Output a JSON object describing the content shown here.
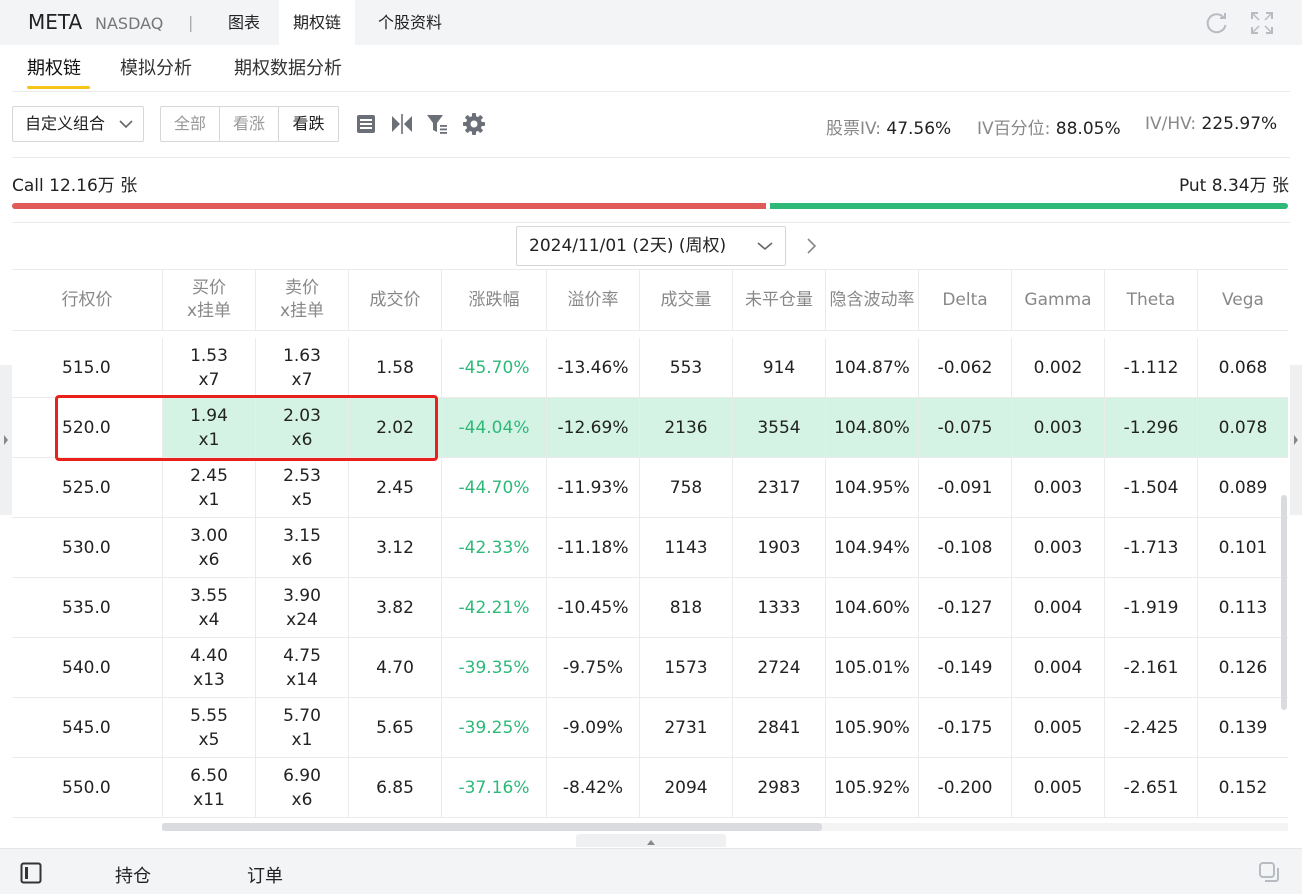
{
  "header": {
    "ticker": "META",
    "exchange": "NASDAQ",
    "separator": "|",
    "tabs": [
      {
        "label": "图表"
      },
      {
        "label": "期权链"
      },
      {
        "label": "个股资料"
      }
    ],
    "icons": [
      "refresh-icon",
      "expand-icon"
    ]
  },
  "subtabs": [
    {
      "label": "期权链"
    },
    {
      "label": "模拟分析"
    },
    {
      "label": "期权数据分析"
    }
  ],
  "toolbar": {
    "combo_label": "自定义组合",
    "segments": [
      {
        "label": "全部"
      },
      {
        "label": "看涨"
      },
      {
        "label": "看跌"
      }
    ],
    "stats": {
      "stock_iv_label": "股票IV:",
      "stock_iv_value": "47.56%",
      "iv_pct_label": "IV百分位:",
      "iv_pct_value": "88.05%",
      "iv_hv_label": "IV/HV:",
      "iv_hv_value": "225.97%"
    }
  },
  "volume": {
    "call_label": "Call 12.16万 张",
    "put_label": "Put 8.34万 张",
    "call_ratio": 0.593
  },
  "expiry": {
    "selected": "2024/11/01 (2天) (周权)"
  },
  "table": {
    "headers": [
      {
        "l1": "行权价",
        "l2": ""
      },
      {
        "l1": "买价",
        "l2": "x挂单"
      },
      {
        "l1": "卖价",
        "l2": "x挂单"
      },
      {
        "l1": "成交价",
        "l2": ""
      },
      {
        "l1": "涨跌幅",
        "l2": ""
      },
      {
        "l1": "溢价率",
        "l2": ""
      },
      {
        "l1": "成交量",
        "l2": ""
      },
      {
        "l1": "未平仓量",
        "l2": ""
      },
      {
        "l1": "隐含波动率",
        "l2": ""
      },
      {
        "l1": "Delta",
        "l2": ""
      },
      {
        "l1": "Gamma",
        "l2": ""
      },
      {
        "l1": "Theta",
        "l2": ""
      },
      {
        "l1": "Vega",
        "l2": ""
      }
    ],
    "rows": [
      {
        "strike": "515.0",
        "bid": "1.53",
        "bid_size": "x7",
        "ask": "1.63",
        "ask_size": "x7",
        "last": "1.58",
        "change": "-45.70%",
        "premium": "-13.46%",
        "volume": "553",
        "open_interest": "914",
        "iv": "104.87%",
        "delta": "-0.062",
        "gamma": "0.002",
        "theta": "-1.112",
        "vega": "0.068"
      },
      {
        "strike": "520.0",
        "bid": "1.94",
        "bid_size": "x1",
        "ask": "2.03",
        "ask_size": "x6",
        "last": "2.02",
        "change": "-44.04%",
        "premium": "-12.69%",
        "volume": "2136",
        "open_interest": "3554",
        "iv": "104.80%",
        "delta": "-0.075",
        "gamma": "0.003",
        "theta": "-1.296",
        "vega": "0.078"
      },
      {
        "strike": "525.0",
        "bid": "2.45",
        "bid_size": "x1",
        "ask": "2.53",
        "ask_size": "x5",
        "last": "2.45",
        "change": "-44.70%",
        "premium": "-11.93%",
        "volume": "758",
        "open_interest": "2317",
        "iv": "104.95%",
        "delta": "-0.091",
        "gamma": "0.003",
        "theta": "-1.504",
        "vega": "0.089"
      },
      {
        "strike": "530.0",
        "bid": "3.00",
        "bid_size": "x6",
        "ask": "3.15",
        "ask_size": "x6",
        "last": "3.12",
        "change": "-42.33%",
        "premium": "-11.18%",
        "volume": "1143",
        "open_interest": "1903",
        "iv": "104.94%",
        "delta": "-0.108",
        "gamma": "0.003",
        "theta": "-1.713",
        "vega": "0.101"
      },
      {
        "strike": "535.0",
        "bid": "3.55",
        "bid_size": "x4",
        "ask": "3.90",
        "ask_size": "x24",
        "last": "3.82",
        "change": "-42.21%",
        "premium": "-10.45%",
        "volume": "818",
        "open_interest": "1333",
        "iv": "104.60%",
        "delta": "-0.127",
        "gamma": "0.004",
        "theta": "-1.919",
        "vega": "0.113"
      },
      {
        "strike": "540.0",
        "bid": "4.40",
        "bid_size": "x13",
        "ask": "4.75",
        "ask_size": "x14",
        "last": "4.70",
        "change": "-39.35%",
        "premium": "-9.75%",
        "volume": "1573",
        "open_interest": "2724",
        "iv": "105.01%",
        "delta": "-0.149",
        "gamma": "0.004",
        "theta": "-2.161",
        "vega": "0.126"
      },
      {
        "strike": "545.0",
        "bid": "5.55",
        "bid_size": "x5",
        "ask": "5.70",
        "ask_size": "x1",
        "last": "5.65",
        "change": "-39.25%",
        "premium": "-9.09%",
        "volume": "2731",
        "open_interest": "2841",
        "iv": "105.90%",
        "delta": "-0.175",
        "gamma": "0.005",
        "theta": "-2.425",
        "vega": "0.139"
      },
      {
        "strike": "550.0",
        "bid": "6.50",
        "bid_size": "x11",
        "ask": "6.90",
        "ask_size": "x6",
        "last": "6.85",
        "change": "-37.16%",
        "premium": "-8.42%",
        "volume": "2094",
        "open_interest": "2983",
        "iv": "105.92%",
        "delta": "-0.200",
        "gamma": "0.005",
        "theta": "-2.651",
        "vega": "0.152"
      }
    ]
  },
  "bottom": {
    "tabs": [
      {
        "label": "持仓"
      },
      {
        "label": "订单"
      }
    ]
  },
  "colors": {
    "accent_yellow": "#f5c518",
    "call_red": "#e05a57",
    "put_green": "#2eb979",
    "highlight_bg": "#d4f3e4",
    "highlight_border": "#e8221b"
  }
}
